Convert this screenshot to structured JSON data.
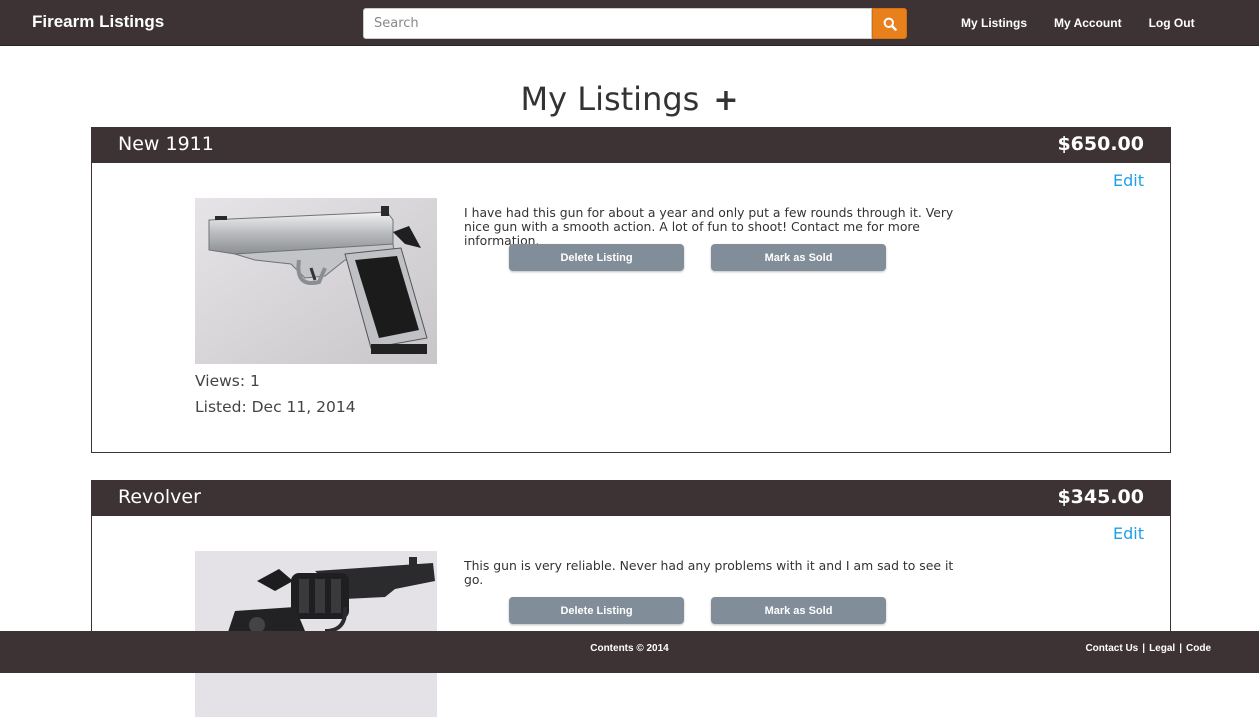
{
  "navbar": {
    "brand": "Firearm Listings",
    "search_placeholder": "Search",
    "links": [
      "My Listings",
      "My Account",
      "Log Out"
    ]
  },
  "page": {
    "title": "My Listings",
    "add_symbol": "+"
  },
  "listings": [
    {
      "title": "New 1911",
      "price": "$650.00",
      "edit": "Edit",
      "description": "I have had this gun for about a year and only put a few rounds through it. Very nice gun with a smooth action. A lot of fun to shoot! Contact me for more information.",
      "delete_label": "Delete Listing",
      "sold_label": "Mark as Sold",
      "views": "Views: 1",
      "listed": "Listed: Dec 11, 2014"
    },
    {
      "title": "Revolver",
      "price": "$345.00",
      "edit": "Edit",
      "description": "This gun is very reliable. Never had any problems with it and I am sad to see it go.",
      "delete_label": "Delete Listing",
      "sold_label": "Mark as Sold"
    }
  ],
  "footer": {
    "copyright": "Contents © 2014",
    "links": [
      "Contact Us",
      "Legal",
      "Code"
    ],
    "separator": "|"
  },
  "colors": {
    "header_bg": "#3d3335",
    "search_button": "#e8801b",
    "link": "#1ea0e6",
    "button_bg": "#818e99"
  }
}
